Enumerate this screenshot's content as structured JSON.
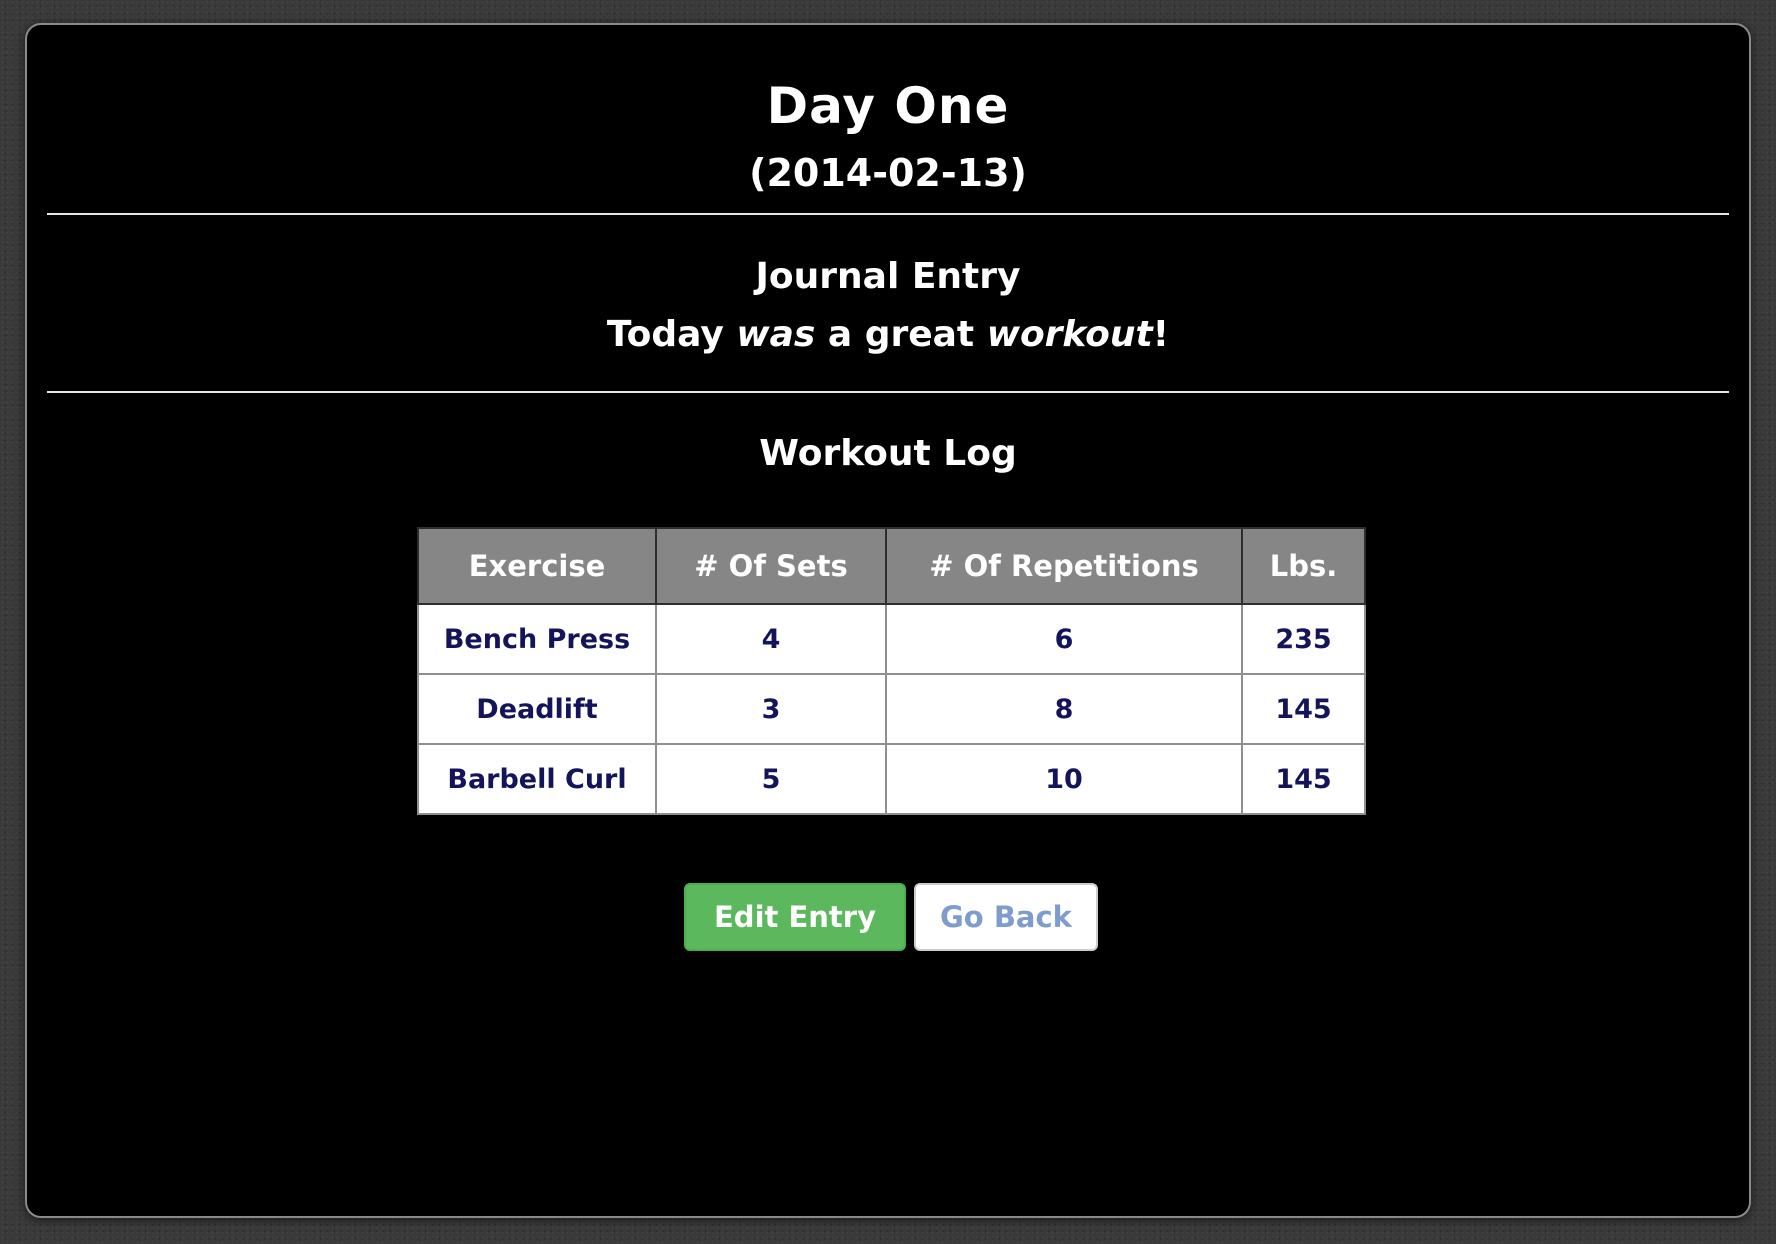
{
  "entry": {
    "title": "Day One",
    "date": "(2014-02-13)"
  },
  "journal": {
    "heading": "Journal Entry",
    "text_part1": "Today ",
    "text_emphasis": "was",
    "text_part2": " a great ",
    "text_emphasis2": "workout",
    "text_part3": "!"
  },
  "workout_log": {
    "heading": "Workout Log",
    "columns": [
      "Exercise",
      "# Of Sets",
      "# Of Repetitions",
      "Lbs."
    ],
    "rows": [
      [
        "Bench Press",
        "4",
        "6",
        "235"
      ],
      [
        "Deadlift",
        "3",
        "8",
        "145"
      ],
      [
        "Barbell Curl",
        "5",
        "10",
        "145"
      ]
    ]
  },
  "actions": {
    "edit_label": "Edit Entry",
    "back_label": "Go Back"
  },
  "colors": {
    "panel_background": "#000000",
    "table_header": "#868686",
    "table_text": "#14145a",
    "edit_button": "#5cb85c",
    "back_button_text": "#7f9ccf"
  }
}
